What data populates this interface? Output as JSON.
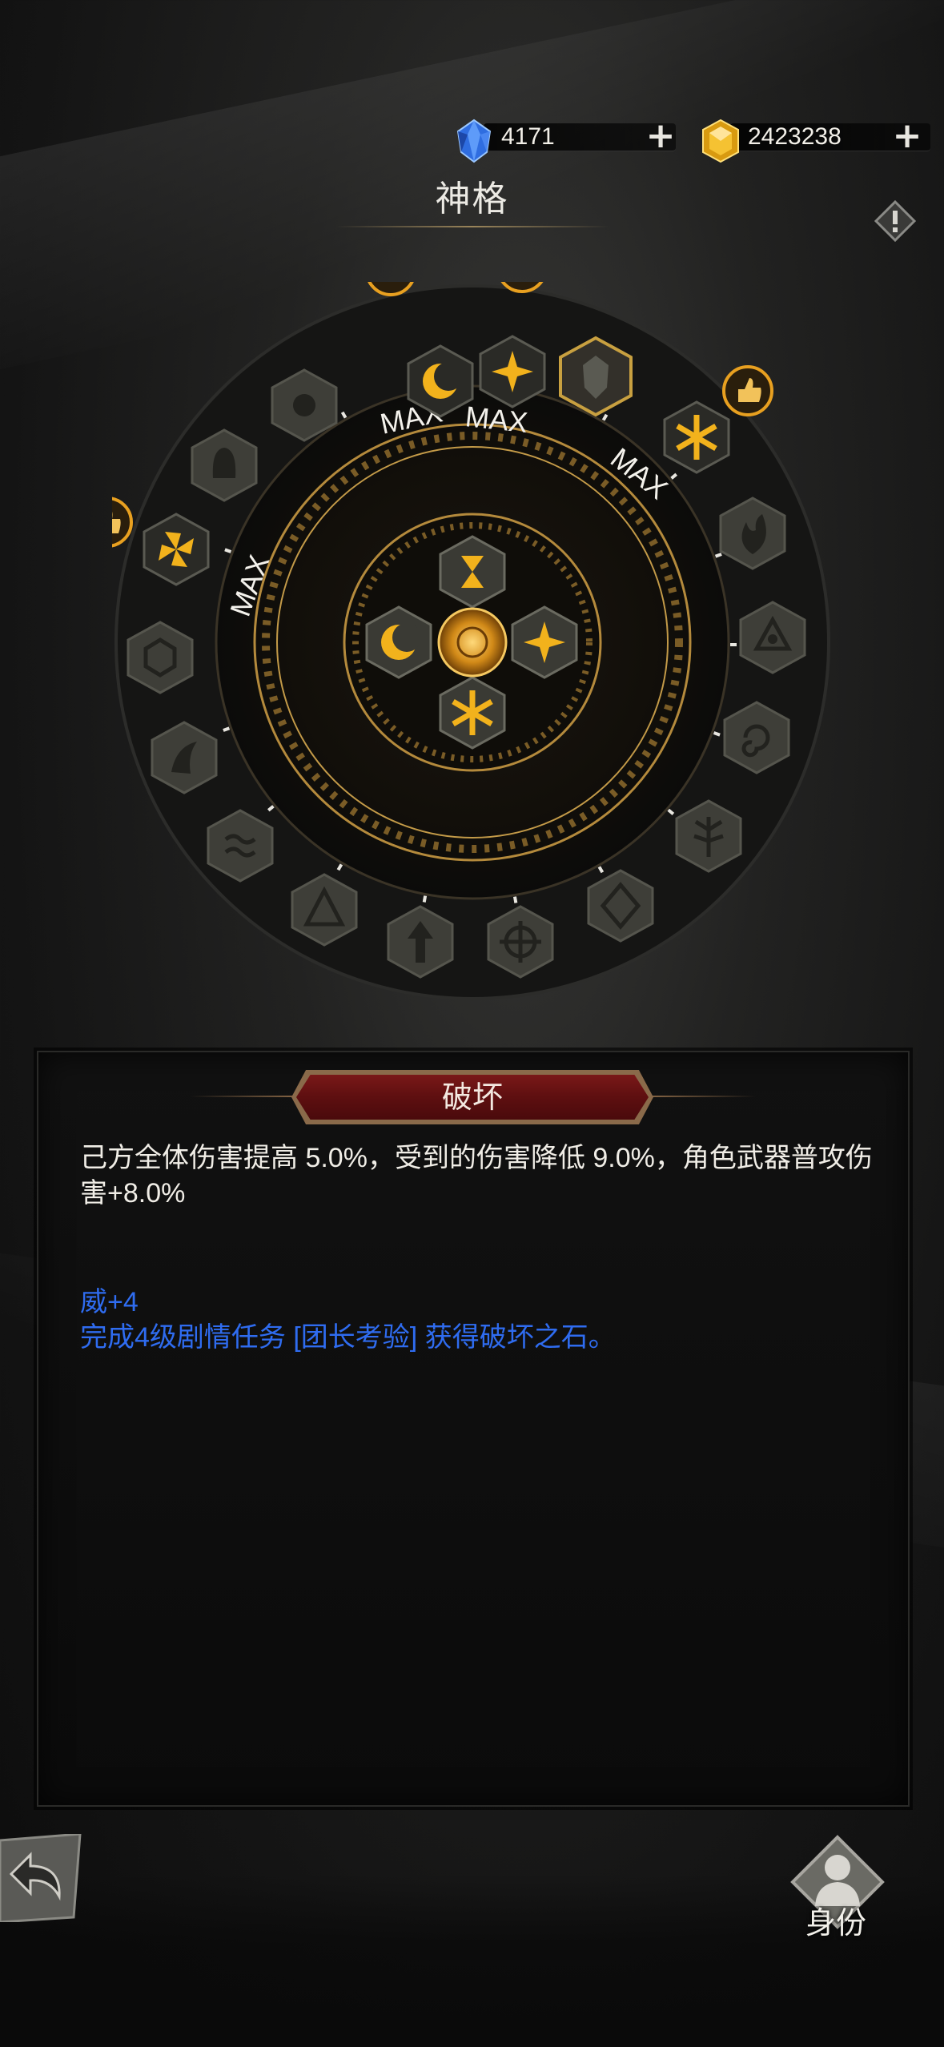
{
  "currency": {
    "gems": {
      "icon": "blue-crystal-icon",
      "value": "4171",
      "add_icon": "plus-icon"
    },
    "gold": {
      "icon": "gold-crystal-icon",
      "value": "2423238",
      "add_icon": "plus-icon"
    }
  },
  "header": {
    "title": "神格",
    "info_icon": "exclamation-icon"
  },
  "wheel": {
    "max_labels": [
      "MAX",
      "MAX",
      "MAX",
      "MAX"
    ],
    "core_icon": "sun-core-icon",
    "inner_slots": [
      "hourglass-icon",
      "crescent-moon-icon",
      "star-burst-icon",
      "asterisk-star-icon"
    ],
    "outer_nodes": [
      "crescent-moon-icon",
      "star-burst-icon",
      "shield-sword-icon",
      "asterisk-star-icon",
      "flame-icon",
      "triangle-knot-icon",
      "swirl-icon",
      "tree-icon",
      "diamond-rune-icon",
      "cross-compass-icon",
      "horned-icon",
      "arrow-up-icon",
      "waves-icon",
      "claw-icon",
      "hexagon-cube-icon",
      "pinwheel-icon",
      "ghost-mask-icon",
      "sun-rays-icon"
    ],
    "thumb_badges": [
      "thumbs-up-icon",
      "thumbs-up-icon",
      "thumbs-up-icon",
      "thumbs-up-icon"
    ],
    "accent": "#f2b21c"
  },
  "panel": {
    "title": "破坏",
    "description": "己方全体伤害提高 5.0%，受到的伤害降低 9.0%，角色武器普攻伤害+8.0%",
    "stat": "威+4",
    "requirement": "完成4级剧情任务 [团长考验] 获得破坏之石。"
  },
  "footer": {
    "back_icon": "back-arrow-icon",
    "identity_icon": "person-icon",
    "identity_label": "身份"
  }
}
